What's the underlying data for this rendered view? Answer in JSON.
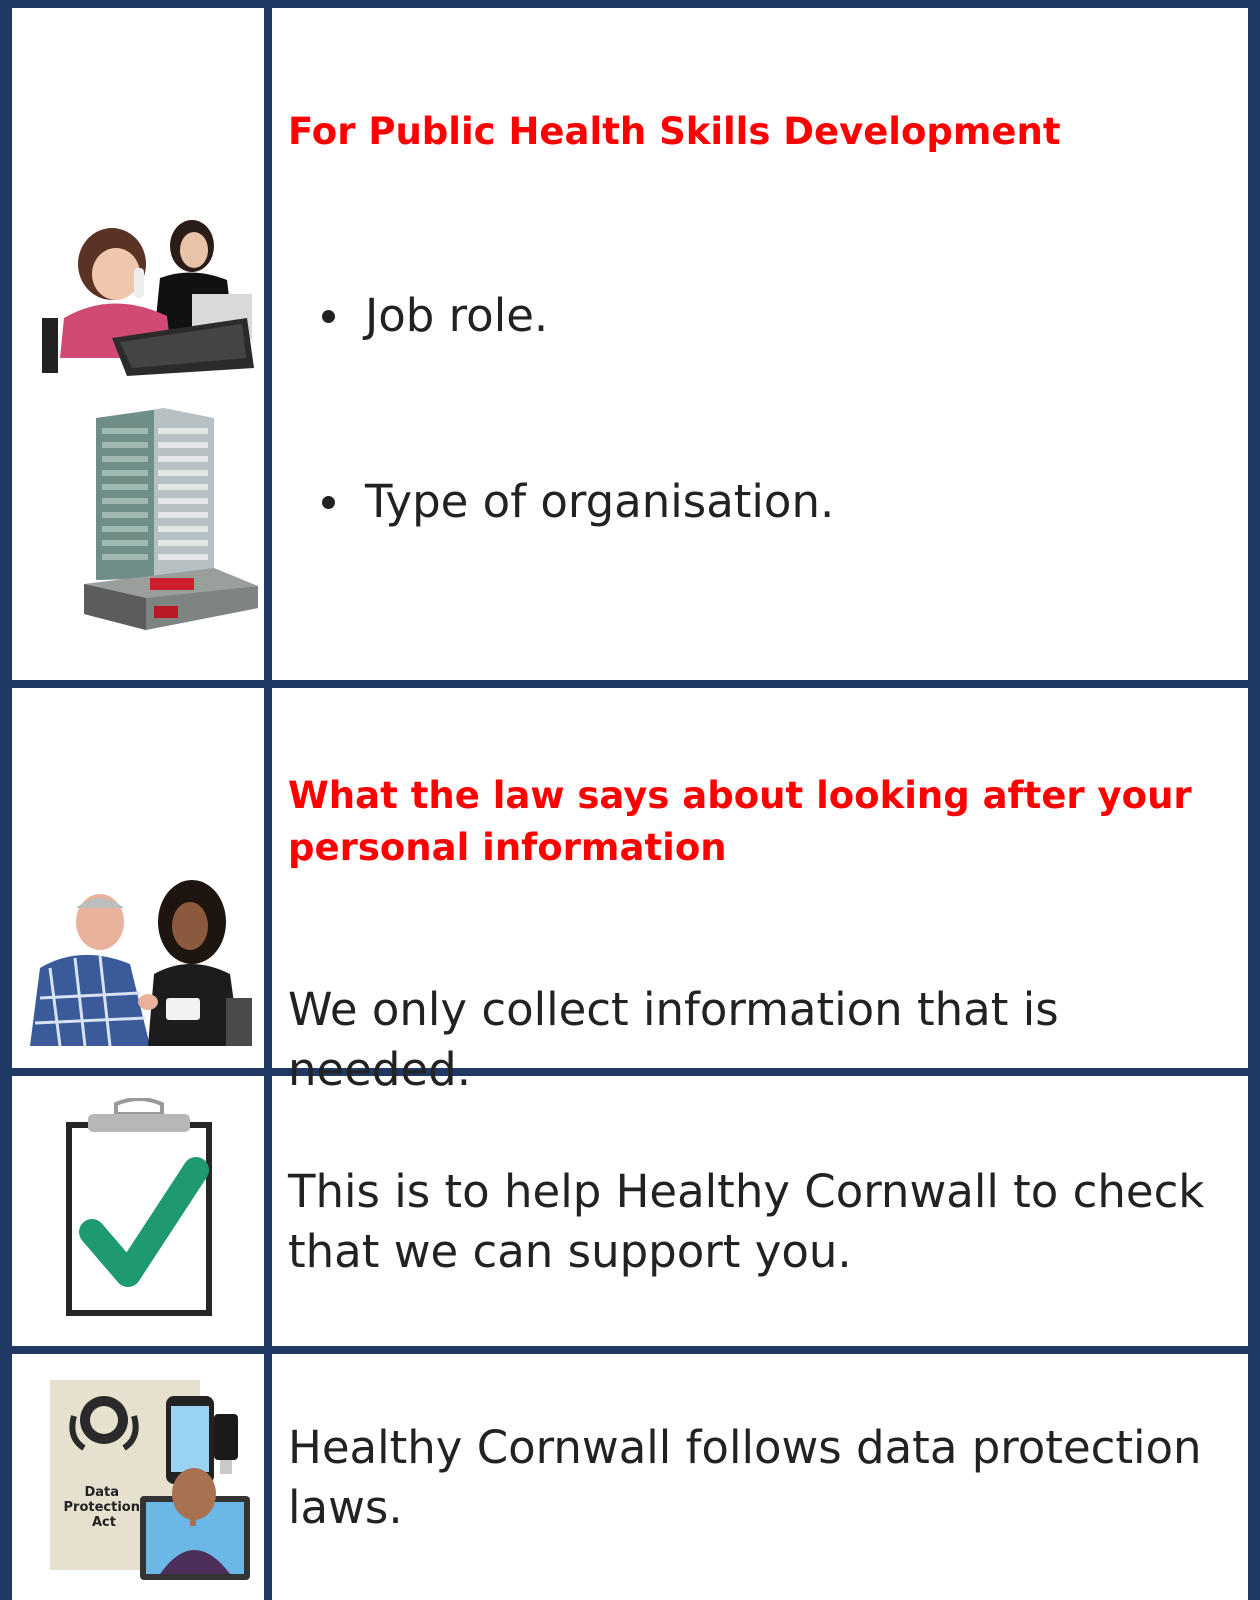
{
  "rows": [
    {
      "heading": "For Public Health Skills Development",
      "bullets": [
        "Job role.",
        "Type of organisation."
      ]
    },
    {
      "heading": "What the law says about looking after your personal information",
      "text": "We only collect information that is needed."
    },
    {
      "text": "This is to help Healthy Cornwall to check that we can support you."
    },
    {
      "text": "Healthy Cornwall follows data protection laws.",
      "image_label_lines": [
        "Data",
        "Protection",
        "Act"
      ]
    }
  ],
  "colors": {
    "border": "#1f3864",
    "heading": "#ff0000",
    "check": "#1e9a6e"
  },
  "icons": [
    "woman-phone-computer-image",
    "office-building-image",
    "two-people-talking-image",
    "clipboard-check-icon",
    "data-protection-image"
  ]
}
